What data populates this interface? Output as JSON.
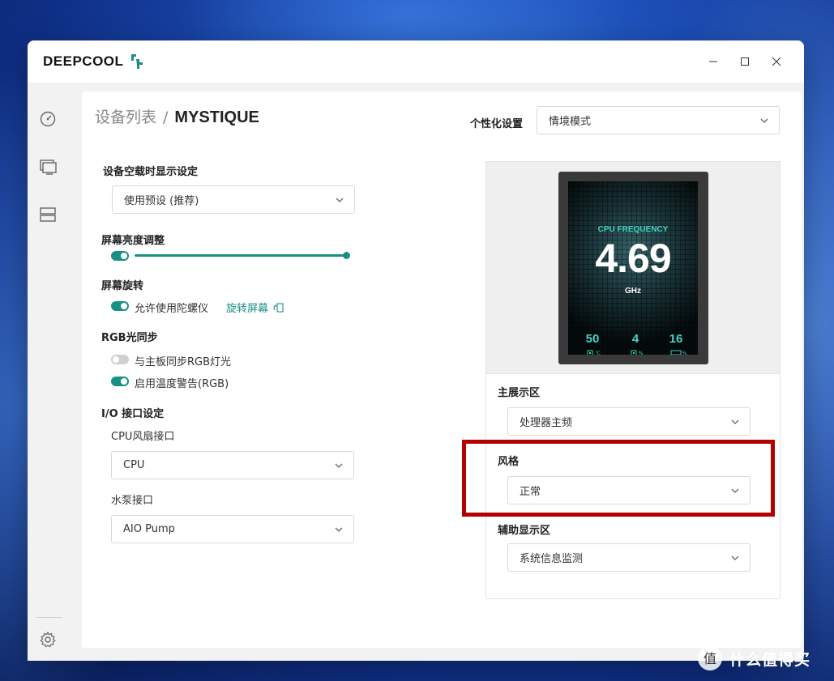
{
  "window": {
    "brand": "DEEPCOOL",
    "controls": {
      "minimize": "minimize-icon",
      "maximize": "maximize-icon",
      "close": "close-icon"
    }
  },
  "sidebar": {
    "items": [
      {
        "icon": "dashboard-gauge-icon"
      },
      {
        "icon": "monitor-icon"
      },
      {
        "icon": "storage-icon"
      }
    ],
    "footer_icon": "settings-gear-icon"
  },
  "breadcrumb": {
    "parent": "设备列表",
    "separator": "/",
    "current": "MYSTIQUE"
  },
  "personalization": {
    "label": "个性化设置",
    "value": "情境模式"
  },
  "idle_display": {
    "label": "设备空载时显示设定",
    "value": "使用预设 (推荐)"
  },
  "brightness": {
    "label": "屏幕亮度调整",
    "enabled": true,
    "level_percent": 100
  },
  "rotation": {
    "label": "屏幕旋转",
    "gyro_label": "允许使用陀螺仪",
    "gyro_enabled": true,
    "rotate_link": "旋转屏幕"
  },
  "rgb_sync": {
    "label": "RGB光同步",
    "motherboard_label": "与主板同步RGB灯光",
    "motherboard_enabled": false,
    "temp_warning_label": "启用温度警告(RGB)",
    "temp_warning_enabled": true
  },
  "io": {
    "label": "I/O 接口设定",
    "cpu_fan_label": "CPU风扇接口",
    "cpu_fan_value": "CPU",
    "pump_label": "水泵接口",
    "pump_value": "AIO Pump"
  },
  "preview": {
    "title": "CPU FREQUENCY",
    "value": "4.69",
    "unit": "GHz",
    "stats": [
      {
        "value": "50",
        "unit": "℃"
      },
      {
        "value": "4",
        "unit": "%"
      },
      {
        "value": "16",
        "unit": "%"
      }
    ]
  },
  "main_display": {
    "label": "主展示区",
    "value": "处理器主频"
  },
  "style": {
    "label": "风格",
    "value": "正常"
  },
  "aux_display": {
    "label": "辅助显示区",
    "value": "系统信息监测"
  },
  "watermark": {
    "text": "什么值得买"
  },
  "colors": {
    "accent": "#1a8f85",
    "highlight": "#b30000"
  }
}
